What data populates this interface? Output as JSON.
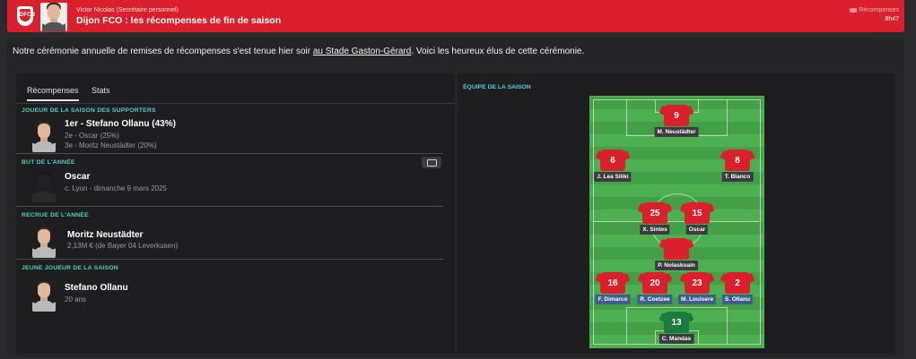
{
  "header": {
    "sender": "Victor Nicolas (Secrétaire personnel)",
    "subject": "Dijon FCO : les récompenses de fin de saison",
    "tag": "Récompenses",
    "time": "8h47",
    "badge_text": "DFCO",
    "bg_color": "#d9202c"
  },
  "intro": {
    "text_before": "Notre cérémonie annuelle de remises de récompenses s'est tenue hier soir ",
    "link": "au Stade Gaston-Gérard",
    "text_after": ". Voici les heureux élus de cette cérémonie."
  },
  "tabs": [
    "Récompenses",
    "Stats"
  ],
  "awards": [
    {
      "title": "JOUEUR DE LA SAISON DES SUPPORTERS",
      "winner": "1er - Stefano Ollanu (43%)",
      "lines": [
        "2e - Oscar (25%)",
        "3e - Moritz Neustädter (20%)"
      ]
    },
    {
      "title": "BUT DE L'ANNÉE",
      "winner": "Oscar",
      "lines": [
        "c. Lyon - dimanche 9 mars 2025"
      ]
    },
    {
      "title": "RECRUE DE L'ANNÉE",
      "winner": "Moritz Neustädter",
      "lines": [
        "2,13M € (de Bayer 04 Leverkusen)"
      ]
    },
    {
      "title": "JEUNE JOUEUR DE LA SAISON",
      "winner": "Stefano Ollanu",
      "lines": [
        "20 ans"
      ]
    }
  ],
  "team": {
    "title": "ÉQUIPE DE LA SAISON",
    "players": [
      {
        "number": "9",
        "name": "M. Neustädter"
      },
      {
        "number": "6",
        "name": "J. Lea Siliki"
      },
      {
        "number": "8",
        "name": "T. Blanco"
      },
      {
        "number": "25",
        "name": "X. Sintes"
      },
      {
        "number": "15",
        "name": "Oscar"
      },
      {
        "number": "",
        "name": "P. Nolaskoain"
      },
      {
        "number": "16",
        "name": "F. Dimarco"
      },
      {
        "number": "20",
        "name": "R. Coetzee"
      },
      {
        "number": "23",
        "name": "M. Louisere"
      },
      {
        "number": "2",
        "name": "S. Ollanu"
      },
      {
        "number": "13",
        "name": "C. Mandas"
      }
    ]
  },
  "colors": {
    "accent": "#4fd1c5",
    "brand": "#d9202c",
    "pitch": "#43a047"
  }
}
